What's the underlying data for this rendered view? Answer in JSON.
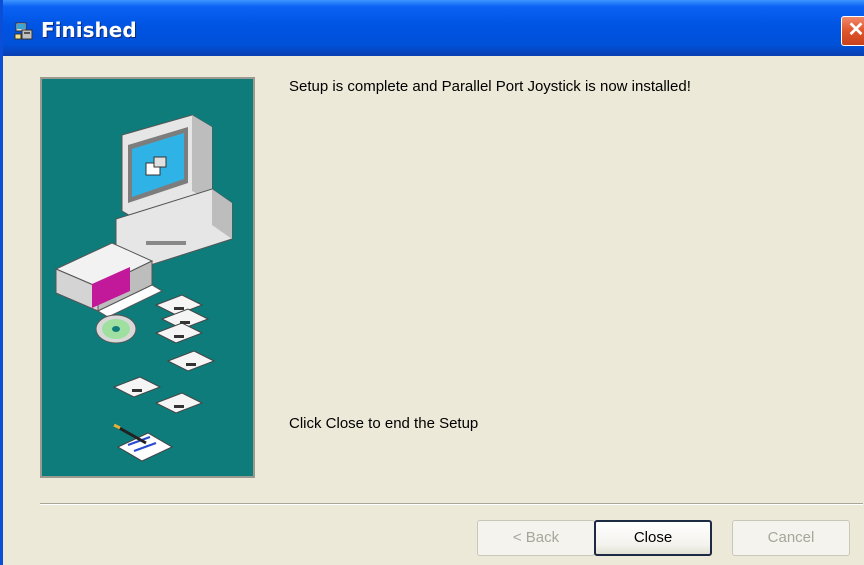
{
  "window": {
    "title": "Finished",
    "close_glyph": "✕"
  },
  "messages": {
    "complete": "Setup is complete and Parallel Port Joystick is now installed!",
    "instruction": "Click Close to end the Setup"
  },
  "buttons": {
    "back": "< Back",
    "close": "Close",
    "cancel": "Cancel"
  },
  "colors": {
    "titlebar": "#0054e3",
    "panel": "#0f7c7c",
    "window_bg": "#ece9d8",
    "close_button": "#e0552b"
  },
  "icons": [
    "setup-icon",
    "close-icon",
    "computer-illustration",
    "box-icon",
    "floppy-disk-icon",
    "cd-icon",
    "document-pen-icon"
  ]
}
